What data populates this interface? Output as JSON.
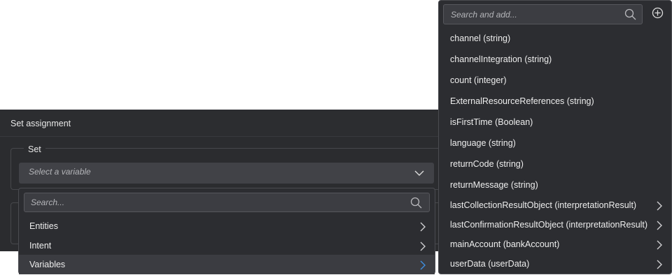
{
  "dialog": {
    "title": "Set assignment",
    "set_legend": "Set",
    "select_placeholder": "Select a variable"
  },
  "left_dropdown": {
    "search_placeholder": "Search...",
    "items": [
      {
        "label": "Entities",
        "has_submenu": true
      },
      {
        "label": "Intent",
        "has_submenu": true
      },
      {
        "label": "Variables",
        "has_submenu": true,
        "active": true
      }
    ]
  },
  "right_dropdown": {
    "search_placeholder": "Search and add...",
    "add_icon": "plus-circle-icon",
    "items": [
      {
        "label": "channel (string)",
        "has_submenu": false
      },
      {
        "label": "channelIntegration (string)",
        "has_submenu": false
      },
      {
        "label": "count (integer)",
        "has_submenu": false
      },
      {
        "label": "ExternalResourceReferences (string)",
        "has_submenu": false
      },
      {
        "label": "isFirstTime (Boolean)",
        "has_submenu": false
      },
      {
        "label": "language (string)",
        "has_submenu": false
      },
      {
        "label": "returnCode (string)",
        "has_submenu": false
      },
      {
        "label": "returnMessage (string)",
        "has_submenu": false
      },
      {
        "label": "lastCollectionResultObject (interpretationResult)",
        "has_submenu": true
      },
      {
        "label": "lastConfirmationResultObject (interpretationResult)",
        "has_submenu": true
      },
      {
        "label": "mainAccount (bankAccount)",
        "has_submenu": true
      },
      {
        "label": "userData (userData)",
        "has_submenu": true
      }
    ]
  },
  "colors": {
    "panel_bg": "#2c2d31",
    "input_bg": "#3c3d42",
    "active_chevron": "#3d8fe0",
    "text": "#eeeeee"
  }
}
